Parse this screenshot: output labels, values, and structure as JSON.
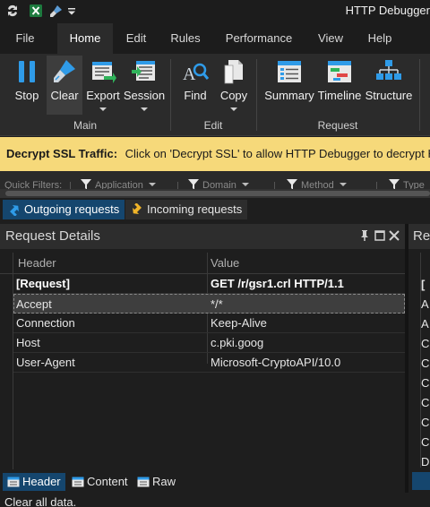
{
  "window": {
    "app_title": "HTTP Debugger",
    "quick_access": [
      {
        "icon": "sync-icon"
      },
      {
        "icon": "excel-icon"
      },
      {
        "icon": "brush-icon"
      },
      {
        "icon": "customize-dropdown-icon"
      }
    ]
  },
  "menu": {
    "tabs": [
      {
        "label": "File",
        "active": false
      },
      {
        "label": "Home",
        "active": true
      },
      {
        "label": "Edit",
        "active": false
      },
      {
        "label": "Rules",
        "active": false
      },
      {
        "label": "Performance",
        "active": false
      },
      {
        "label": "View",
        "active": false
      },
      {
        "label": "Help",
        "active": false
      }
    ]
  },
  "ribbon": {
    "groups": [
      {
        "label": "Main"
      },
      {
        "label": "Edit"
      },
      {
        "label": "Request"
      }
    ],
    "buttons": [
      {
        "label": "Stop",
        "icon": "pause-icon",
        "dropdown": false,
        "selected": false
      },
      {
        "label": "Clear",
        "icon": "clear-brush-icon",
        "dropdown": false,
        "selected": true
      },
      {
        "label": "Export",
        "icon": "export-icon",
        "dropdown": true,
        "selected": false
      },
      {
        "label": "Session",
        "icon": "session-icon",
        "dropdown": true,
        "selected": false
      },
      {
        "label": "Find",
        "icon": "find-icon",
        "dropdown": false,
        "selected": false
      },
      {
        "label": "Copy",
        "icon": "copy-icon",
        "dropdown": true,
        "selected": false
      },
      {
        "label": "Summary",
        "icon": "summary-icon",
        "dropdown": false,
        "selected": false
      },
      {
        "label": "Timeline",
        "icon": "timeline-icon",
        "dropdown": false,
        "selected": false
      },
      {
        "label": "Structure",
        "icon": "structure-icon",
        "dropdown": false,
        "selected": false
      }
    ]
  },
  "banner": {
    "title": "Decrypt SSL Traffic:",
    "message": "Click on 'Decrypt SSL' to allow HTTP Debugger to decrypt HTTPS"
  },
  "quick_filters": {
    "label": "Quick Filters:",
    "items": [
      {
        "label": "Application"
      },
      {
        "label": "Domain"
      },
      {
        "label": "Method"
      },
      {
        "label": "Type"
      }
    ]
  },
  "direction_tabs": [
    {
      "label": "Outgoing requests",
      "active": true,
      "icon": "outgoing-icon"
    },
    {
      "label": "Incoming requests",
      "active": false,
      "icon": "incoming-icon"
    }
  ],
  "request_details": {
    "title": "Request Details",
    "controls": [
      {
        "icon": "pin-icon"
      },
      {
        "icon": "maximize-icon"
      },
      {
        "icon": "close-icon"
      }
    ],
    "columns": [
      "Header",
      "Value"
    ],
    "rows": [
      {
        "header": "[Request]",
        "value": "GET /r/gsr1.crl HTTP/1.1",
        "bold": true,
        "selected": false
      },
      {
        "header": "Accept",
        "value": "*/*",
        "bold": false,
        "selected": true
      },
      {
        "header": "Connection",
        "value": "Keep-Alive",
        "bold": false,
        "selected": false
      },
      {
        "header": "Host",
        "value": "c.pki.goog",
        "bold": false,
        "selected": false
      },
      {
        "header": "User-Agent",
        "value": "Microsoft-CryptoAPI/10.0",
        "bold": false,
        "selected": false
      }
    ],
    "bottom_tabs": [
      {
        "label": "Header",
        "active": true
      },
      {
        "label": "Content",
        "active": false
      },
      {
        "label": "Raw",
        "active": false
      }
    ]
  },
  "response_panel": {
    "title": "Re",
    "rows": [
      "[",
      "A",
      "A",
      "C",
      "C",
      "C",
      "C",
      "C",
      "C",
      "D"
    ]
  },
  "status": {
    "text": "Clear all data."
  }
}
